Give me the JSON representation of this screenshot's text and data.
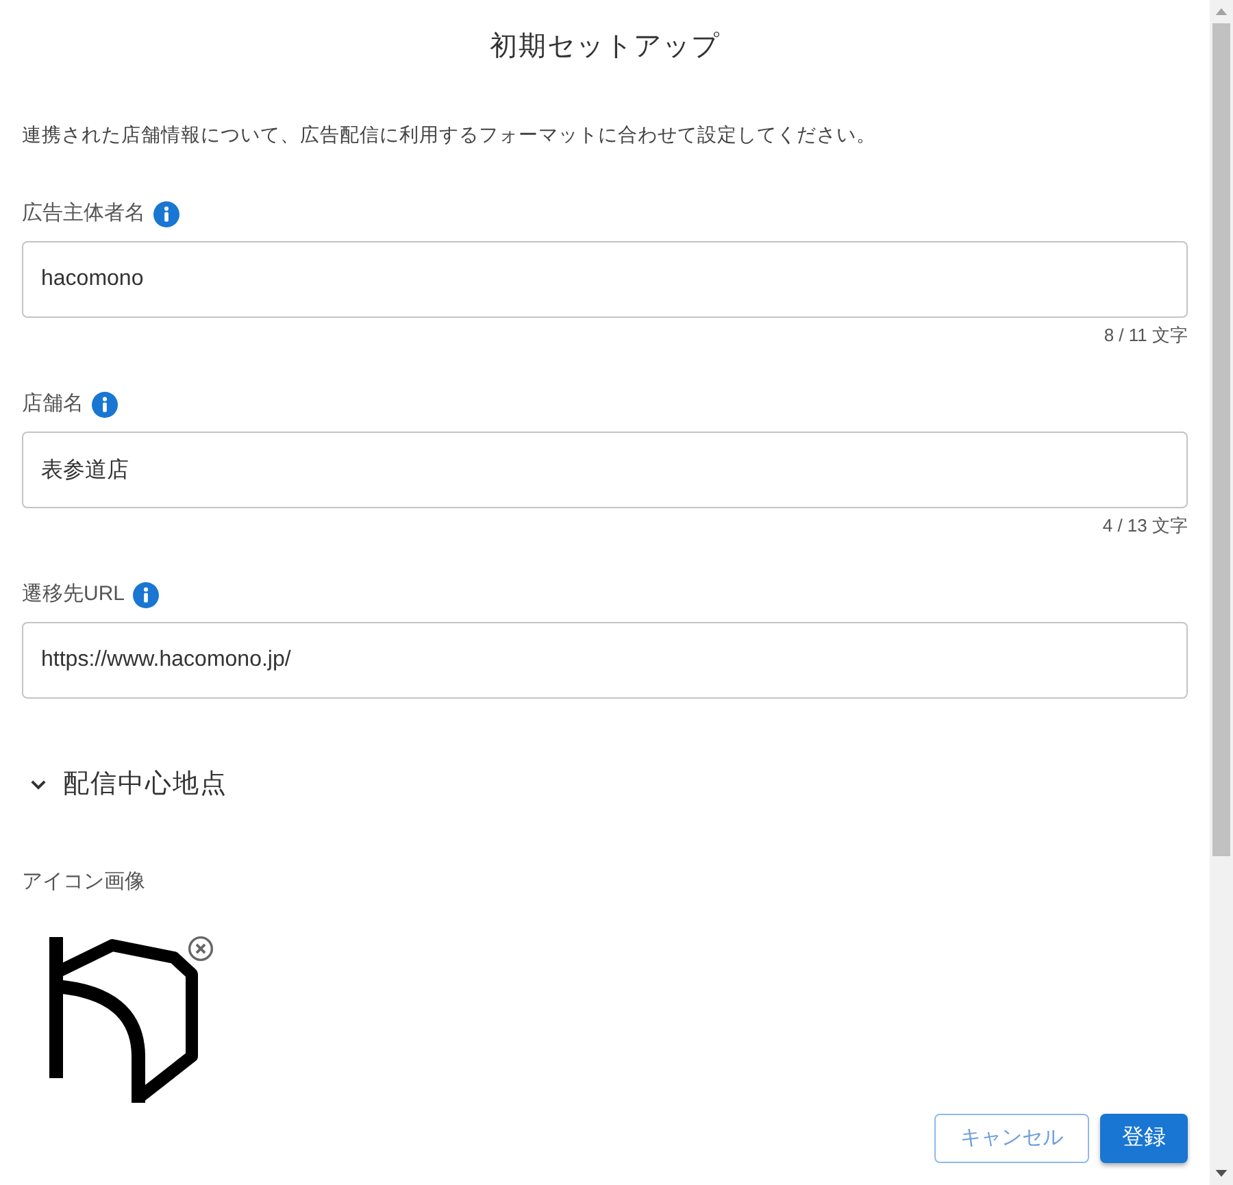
{
  "dialog": {
    "title": "初期セットアップ",
    "description": "連携された店舗情報について、広告配信に利用するフォーマットに合わせて設定してください。"
  },
  "fields": [
    {
      "label": "広告主体者名",
      "info": true,
      "value": "hacomono",
      "counter": "8 / 11 文字"
    },
    {
      "label": "店舗名",
      "info": true,
      "value": "表参道店",
      "counter": "4 / 13 文字"
    },
    {
      "label": "遷移先URL",
      "info": true,
      "value": "https://www.hacomono.jp/"
    }
  ],
  "accordion": {
    "label": "配信中心地点",
    "expanded": false
  },
  "icon_image": {
    "label": "アイコン画像"
  },
  "buttons": [
    {
      "label": "キャンセル",
      "kind": "outlined"
    },
    {
      "label": "登録",
      "kind": "contained"
    }
  ]
}
